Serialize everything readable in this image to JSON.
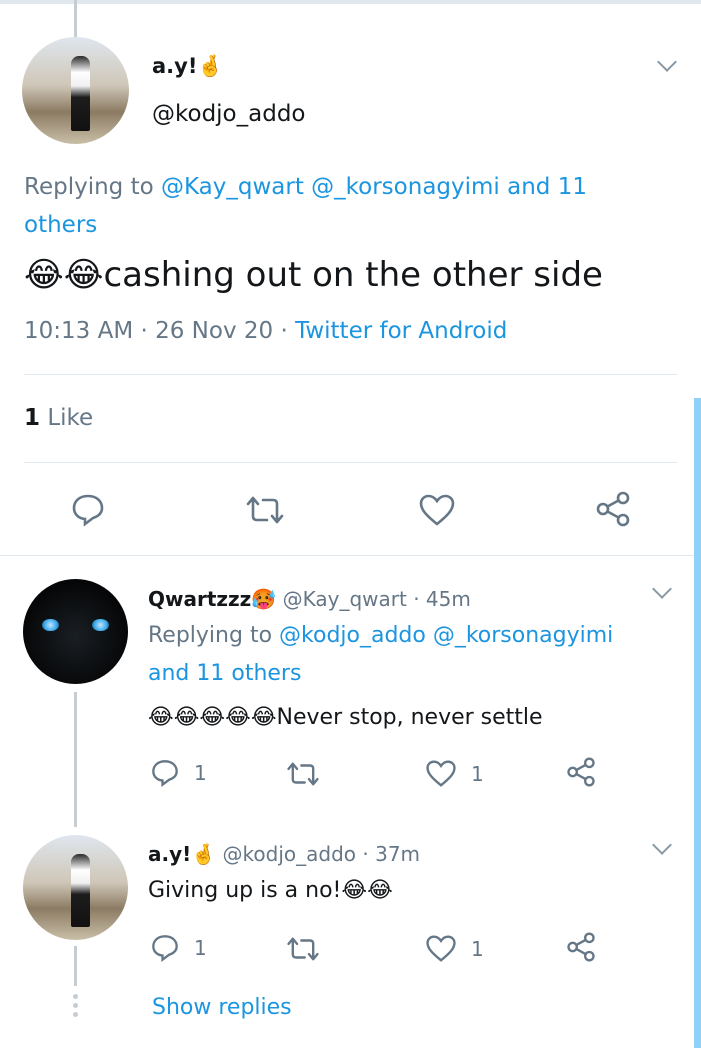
{
  "main_tweet": {
    "display_name": "a.y!",
    "name_emoji": "🤞",
    "handle": "@kodjo_addo",
    "replying_prefix": "Replying to",
    "replying_targets": "@Kay_qwart @_korsonagyimi and 11 others",
    "emoji_prefix": "😂😂",
    "text": "cashing out on the other side",
    "time": "10:13 AM",
    "date": "26 Nov 20",
    "separator": "·",
    "client": "Twitter for Android",
    "likes_count": "1",
    "likes_label": "Like"
  },
  "replies": [
    {
      "display_name": "Qwartzzz",
      "name_emoji": "🥵",
      "handle": "@Kay_qwart",
      "age": "· 45m",
      "replying_prefix": "Replying to",
      "replying_targets_line1": "@kodjo_addo @_korsonagyimi",
      "replying_targets_line2": "and 11 others",
      "emoji_prefix": "😂😂😂😂😂",
      "text": "Never stop, never settle",
      "reply_count": "1",
      "like_count": "1"
    },
    {
      "display_name": "a.y!",
      "name_emoji": "🤞",
      "handle": "@kodjo_addo",
      "age": "· 37m",
      "text": "Giving up is a no!",
      "emoji_suffix": "😂😂",
      "reply_count": "1",
      "like_count": "1"
    }
  ],
  "show_replies": "Show replies",
  "icons": [
    "reply-icon",
    "retweet-icon",
    "like-icon",
    "share-icon",
    "chevron-down-icon"
  ],
  "colors": {
    "link_blue": "#1b95e0",
    "meta_grey": "#657786",
    "scrollbar": "#8fd2f7"
  }
}
